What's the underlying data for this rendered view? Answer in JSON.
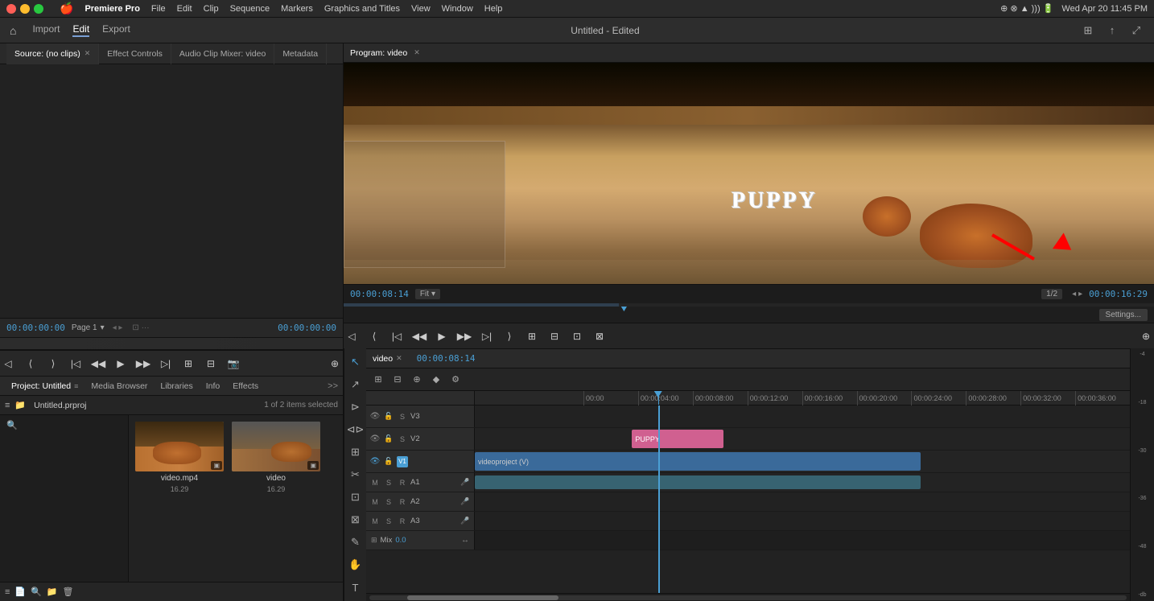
{
  "menubar": {
    "apple": "🍎",
    "app_name": "Premiere Pro",
    "menus": [
      "File",
      "Edit",
      "Clip",
      "Sequence",
      "Markers",
      "Graphics and Titles",
      "View",
      "Window",
      "Help"
    ],
    "title": "Untitled - Edited",
    "time": "Wed Apr 20  11:45 PM"
  },
  "toolbar": {
    "import": "Import",
    "edit": "Edit",
    "export": "Export"
  },
  "source_panel": {
    "tabs": [
      {
        "label": "Source: (no clips)",
        "has_close": true
      },
      {
        "label": "Effect Controls",
        "has_close": false
      },
      {
        "label": "Audio Clip Mixer: video",
        "has_close": false
      },
      {
        "label": "Metadata",
        "has_close": false
      }
    ]
  },
  "timecode_left": "00:00:00:00",
  "timecode_right": "00:00:00:00",
  "page_selector": "Page 1",
  "program_monitor": {
    "title": "Program: video",
    "timecode_in": "00:00:08:14",
    "fit_label": "Fit",
    "pages_label": "1/2",
    "timecode_out": "00:00:16:29",
    "settings_label": "Settings...",
    "puppy_text": "PUPPY"
  },
  "project_panel": {
    "tabs": [
      {
        "label": "Project: Untitled",
        "active": true
      },
      {
        "label": "Media Browser"
      },
      {
        "label": "Libraries"
      },
      {
        "label": "Info"
      },
      {
        "label": "Effects"
      }
    ],
    "folder": "Untitled.prproj",
    "count": "1 of 2 items selected",
    "clips": [
      {
        "name": "video.mp4",
        "duration": "16.29",
        "type": "dog1"
      },
      {
        "name": "video",
        "duration": "16.29",
        "type": "dog2"
      }
    ]
  },
  "timeline": {
    "tab_label": "video",
    "timecode": "00:00:08:14",
    "ruler_labels": [
      "00:00",
      "00:00:04:00",
      "00:00:08:00",
      "00:00:12:00",
      "00:00:16:00",
      "00:00:20:00",
      "00:00:24:00",
      "00:00:28:00",
      "00:00:32:00",
      "00:00:36:00"
    ],
    "tracks": [
      {
        "id": "V3",
        "label": "V3",
        "type": "video",
        "has_clip": false
      },
      {
        "id": "V2",
        "label": "V2",
        "type": "video",
        "has_clip": "title",
        "clip_label": "PUPPY"
      },
      {
        "id": "V1",
        "label": "V1",
        "type": "video",
        "has_clip": "video",
        "clip_label": "videoproject (V)"
      },
      {
        "id": "A1",
        "label": "A1",
        "type": "audio",
        "has_clip": "audio"
      },
      {
        "id": "A2",
        "label": "A2",
        "type": "audio",
        "has_clip": false
      },
      {
        "id": "A3",
        "label": "A3",
        "type": "audio",
        "has_clip": false
      }
    ],
    "mix_label": "Mix",
    "mix_value": "0.0"
  }
}
